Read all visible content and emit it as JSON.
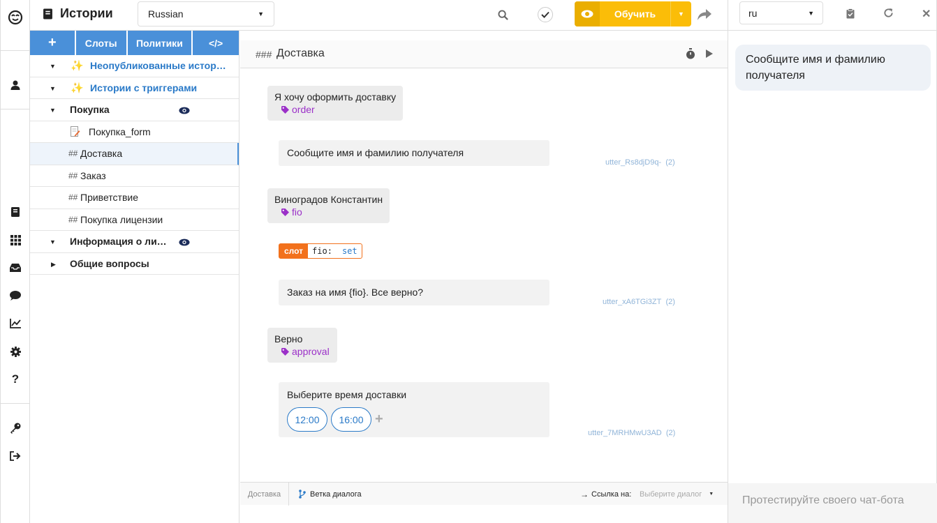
{
  "header": {
    "title": "Истории",
    "language": "Russian",
    "train_label": "Обучить"
  },
  "toolbar": {
    "add": "+",
    "slots": "Слоты",
    "policies": "Политики",
    "code": "</>"
  },
  "tree": {
    "items": [
      {
        "label": "Неопубликованные истор…"
      },
      {
        "label": "Истории с триггерами"
      },
      {
        "label": "Покупка"
      },
      {
        "label": "Покупка_form"
      },
      {
        "label": "Доставка"
      },
      {
        "label": "Заказ"
      },
      {
        "label": "Приветствие"
      },
      {
        "label": "Покупка лицензии"
      },
      {
        "label": "Информация о ли…"
      },
      {
        "label": "Общие вопросы"
      }
    ]
  },
  "story": {
    "title": "Доставка",
    "messages": [
      {
        "text": "Я хочу оформить доставку",
        "intent": "order"
      },
      {
        "text": "Сообщите имя и фамилию получателя",
        "utter": "utter_Rs8djD9q-",
        "count": "(2)"
      },
      {
        "text": "Виноградов Константин",
        "intent": "fio"
      },
      {
        "text": "Заказ на имя {fio}. Все верно?",
        "utter": "utter_xA6TGi3ZT",
        "count": "(2)"
      },
      {
        "text": "Верно",
        "intent": "approval"
      },
      {
        "text": "Выберите время доставки",
        "utter": "utter_7MRHMwU3AD",
        "count": "(2)"
      }
    ],
    "slot": {
      "tag": "слот",
      "name": "fio:",
      "value": "set"
    },
    "quick_replies": [
      "12:00",
      "16:00"
    ]
  },
  "footer": {
    "crumb": "Доставка",
    "branch": "Ветка диалога",
    "link_label": "Ссылка на:",
    "link_placeholder": "Выберите диалог"
  },
  "chat": {
    "language": "ru",
    "bot_message": "Сообщите имя и фамилию получателя",
    "input_placeholder": "Протестируйте своего чат-бота"
  },
  "colors": {
    "primary": "#4a90d9",
    "train": "#fbbd08",
    "intent": "#9b30c8",
    "slot": "#f2711c"
  }
}
